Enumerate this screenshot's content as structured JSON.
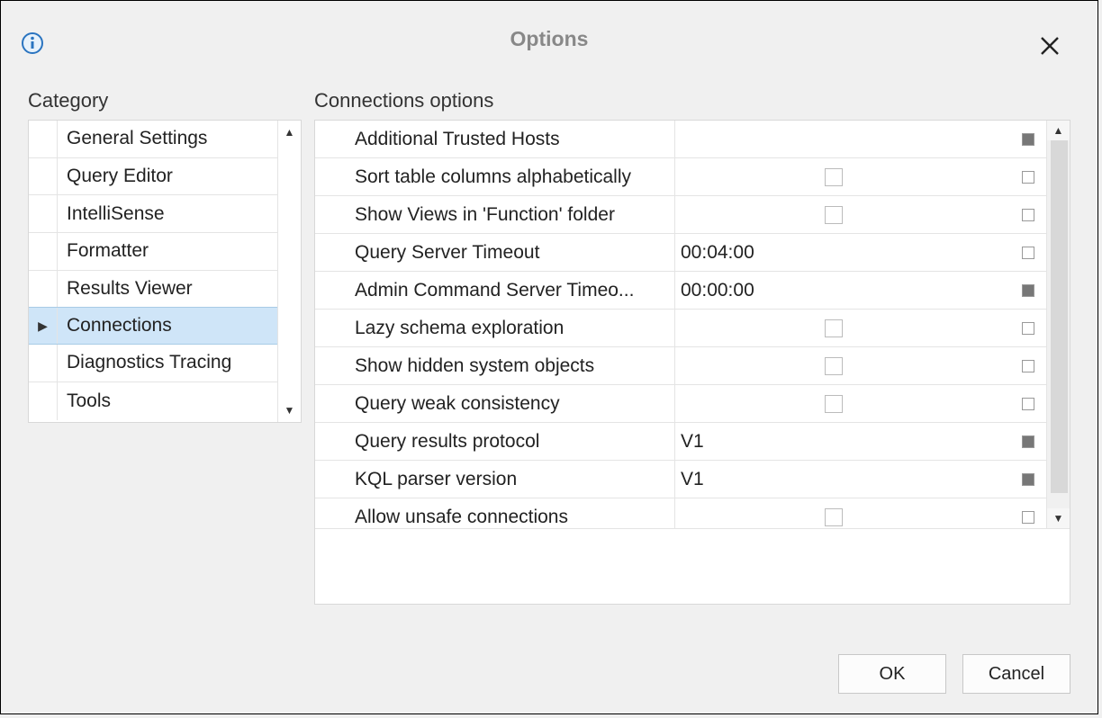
{
  "title": "Options",
  "category_label": "Category",
  "options_label": "Connections options",
  "categories": [
    {
      "label": "General Settings",
      "selected": false
    },
    {
      "label": "Query Editor",
      "selected": false
    },
    {
      "label": "IntelliSense",
      "selected": false
    },
    {
      "label": "Formatter",
      "selected": false
    },
    {
      "label": "Results Viewer",
      "selected": false
    },
    {
      "label": "Connections",
      "selected": true
    },
    {
      "label": "Diagnostics Tracing",
      "selected": false
    },
    {
      "label": "Tools",
      "selected": false
    }
  ],
  "options": [
    {
      "name": "Additional Trusted Hosts",
      "value": "",
      "checkbox": false,
      "reset_dark": true
    },
    {
      "name": "Sort table columns alphabetically",
      "value": "",
      "checkbox": true,
      "reset_dark": false
    },
    {
      "name": "Show Views in 'Function' folder",
      "value": "",
      "checkbox": true,
      "reset_dark": false
    },
    {
      "name": "Query Server Timeout",
      "value": "00:04:00",
      "checkbox": false,
      "reset_dark": false
    },
    {
      "name": "Admin Command Server Timeo...",
      "value": "00:00:00",
      "checkbox": false,
      "reset_dark": true
    },
    {
      "name": "Lazy schema exploration",
      "value": "",
      "checkbox": true,
      "reset_dark": false
    },
    {
      "name": "Show hidden system objects",
      "value": "",
      "checkbox": true,
      "reset_dark": false
    },
    {
      "name": "Query weak consistency",
      "value": "",
      "checkbox": true,
      "reset_dark": false
    },
    {
      "name": "Query results protocol",
      "value": "V1",
      "checkbox": false,
      "reset_dark": true
    },
    {
      "name": "KQL parser version",
      "value": "V1",
      "checkbox": false,
      "reset_dark": true
    },
    {
      "name": "Allow unsafe connections",
      "value": "",
      "checkbox": true,
      "reset_dark": false
    }
  ],
  "buttons": {
    "ok": "OK",
    "cancel": "Cancel"
  }
}
